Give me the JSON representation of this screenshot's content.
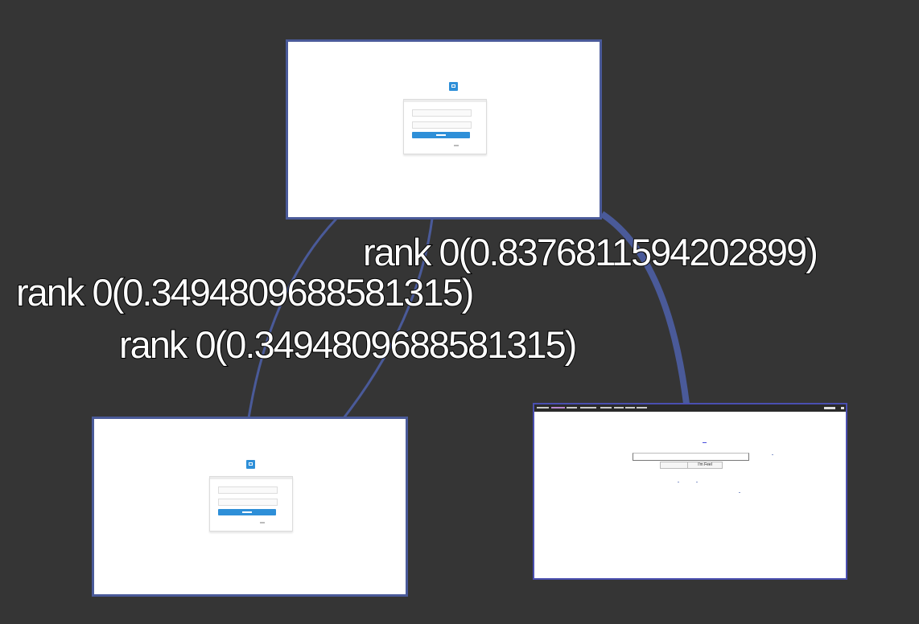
{
  "edges": [
    {
      "from": "login-page-a",
      "to": "search-page",
      "rank": 0,
      "score": 0.8376811594202899,
      "label": "rank 0(0.8376811594202899)"
    },
    {
      "from": "login-page-a",
      "to": "login-page-b",
      "rank": 0,
      "score": 0.3494809688581315,
      "label": "rank 0(0.3494809688581315)"
    },
    {
      "from": "login-page-a",
      "to": "login-page-b",
      "rank": 0,
      "score": 0.3494809688581315,
      "label": "rank 0(0.3494809688581315)"
    }
  ],
  "nodes": {
    "search_page": {
      "lucky_button": "I'm Feel"
    }
  },
  "colors": {
    "background": "#353535",
    "edge": "#4a5a99",
    "node_border": "#4a5a99",
    "login_accent": "#2e8fd8"
  }
}
